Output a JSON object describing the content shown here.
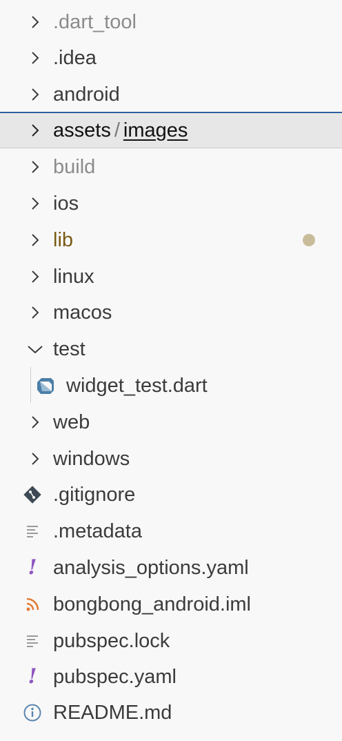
{
  "explorer": {
    "items": [
      {
        "label": ".dart_tool",
        "kind": "folder",
        "state": "collapsed",
        "muted": true
      },
      {
        "label": ".idea",
        "kind": "folder",
        "state": "collapsed"
      },
      {
        "label": "android",
        "kind": "folder",
        "state": "collapsed"
      },
      {
        "label": "assets",
        "sub": "images",
        "separator": "/",
        "kind": "folder",
        "state": "collapsed",
        "selected": true
      },
      {
        "label": "build",
        "kind": "folder",
        "state": "collapsed",
        "muted": true
      },
      {
        "label": "ios",
        "kind": "folder",
        "state": "collapsed"
      },
      {
        "label": "lib",
        "kind": "folder",
        "state": "collapsed",
        "modified": true
      },
      {
        "label": "linux",
        "kind": "folder",
        "state": "collapsed"
      },
      {
        "label": "macos",
        "kind": "folder",
        "state": "collapsed"
      },
      {
        "label": "test",
        "kind": "folder",
        "state": "expanded"
      },
      {
        "label": "widget_test.dart",
        "kind": "file",
        "icon": "dart-icon",
        "indent": 1
      },
      {
        "label": "web",
        "kind": "folder",
        "state": "collapsed"
      },
      {
        "label": "windows",
        "kind": "folder",
        "state": "collapsed"
      },
      {
        "label": ".gitignore",
        "kind": "file",
        "icon": "git-icon"
      },
      {
        "label": ".metadata",
        "kind": "file",
        "icon": "text-lines-icon"
      },
      {
        "label": "analysis_options.yaml",
        "kind": "file",
        "icon": "yaml-exclamation-icon"
      },
      {
        "label": "bongbong_android.iml",
        "kind": "file",
        "icon": "rss-feed-icon"
      },
      {
        "label": "pubspec.lock",
        "kind": "file",
        "icon": "text-lines-icon"
      },
      {
        "label": "pubspec.yaml",
        "kind": "file",
        "icon": "yaml-exclamation-icon"
      },
      {
        "label": "README.md",
        "kind": "file",
        "icon": "info-circle-icon"
      }
    ]
  },
  "colors": {
    "background": "#f8f8f8",
    "text": "#3b3b3b",
    "muted_text": "#8b8b8b",
    "modified_text": "#7a5a16",
    "modified_dot": "#c9bc9a",
    "selection_border": "#2b5fa1",
    "selection_bg": "#e7e7e7",
    "yaml_icon": "#8e57c0",
    "rss_icon": "#e37933",
    "dart_icon": "#4c7fa8",
    "info_icon": "#5a86b0"
  }
}
